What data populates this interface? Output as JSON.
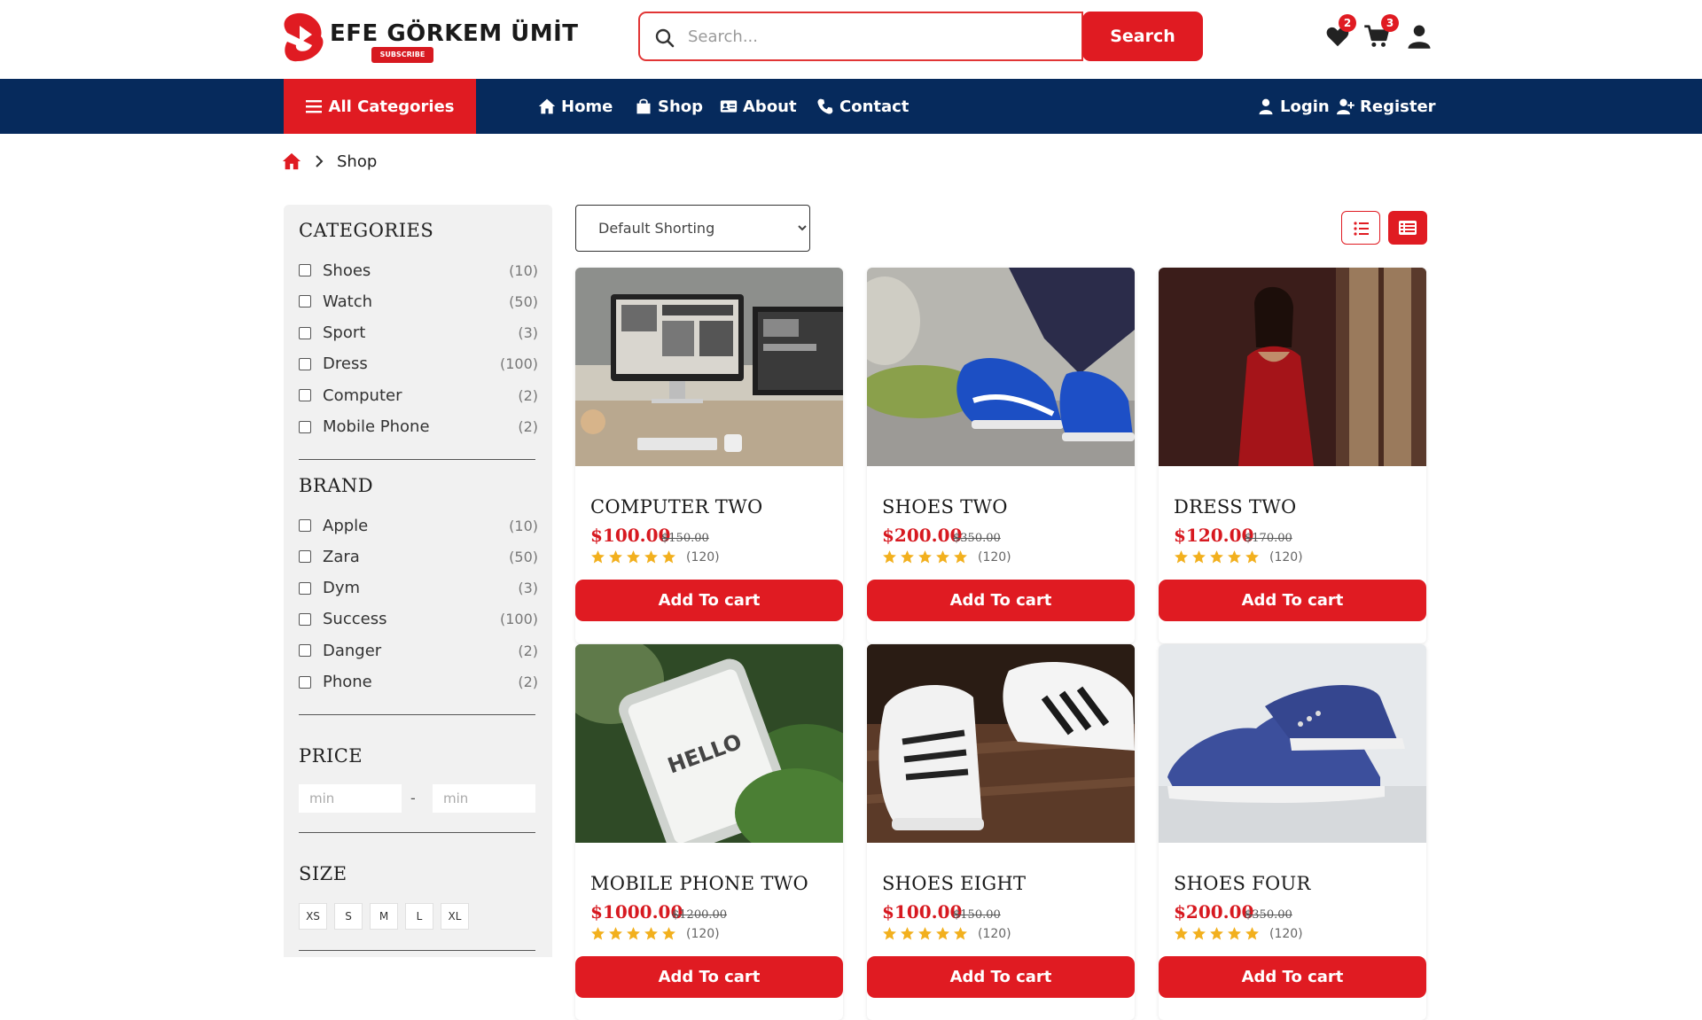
{
  "header": {
    "logo_text": "EFE GÖRKEM ÜMİT",
    "logo_sub": "SUBSCRIBE",
    "search_placeholder": "Search...",
    "search_button": "Search",
    "wishlist_count": "2",
    "cart_count": "3"
  },
  "nav": {
    "all_categories": "All Categories",
    "home": "Home",
    "shop": "Shop",
    "about": "About",
    "contact": "Contact",
    "login": "Login",
    "register": "Register"
  },
  "breadcrumb": {
    "current": "Shop"
  },
  "sidebar": {
    "categories_title": "CATEGORIES",
    "categories": [
      {
        "label": "Shoes",
        "count": "(10)"
      },
      {
        "label": "Watch",
        "count": "(50)"
      },
      {
        "label": "Sport",
        "count": "(3)"
      },
      {
        "label": "Dress",
        "count": "(100)"
      },
      {
        "label": "Computer",
        "count": "(2)"
      },
      {
        "label": "Mobile Phone",
        "count": "(2)"
      }
    ],
    "brand_title": "BRAND",
    "brands": [
      {
        "label": "Apple",
        "count": "(10)"
      },
      {
        "label": "Zara",
        "count": "(50)"
      },
      {
        "label": "Dym",
        "count": "(3)"
      },
      {
        "label": "Success",
        "count": "(100)"
      },
      {
        "label": "Danger",
        "count": "(2)"
      },
      {
        "label": "Phone",
        "count": "(2)"
      }
    ],
    "price_title": "PRICE",
    "price_min_placeholder": "min",
    "price_max_placeholder": "min",
    "price_dash": "-",
    "size_title": "SIZE",
    "sizes": [
      "XS",
      "S",
      "M",
      "L",
      "XL"
    ]
  },
  "toolbar": {
    "sort_selected": "Default Shorting"
  },
  "products": [
    {
      "name": "COMPUTER TWO",
      "price": "$100.00",
      "old_price": "$150.00",
      "reviews": "(120)",
      "rating": 5,
      "button": "Add To cart"
    },
    {
      "name": "SHOES TWO",
      "price": "$200.00",
      "old_price": "$350.00",
      "reviews": "(120)",
      "rating": 5,
      "button": "Add To cart"
    },
    {
      "name": "DRESS TWO",
      "price": "$120.00",
      "old_price": "$170.00",
      "reviews": "(120)",
      "rating": 5,
      "button": "Add To cart"
    },
    {
      "name": "MOBILE PHONE TWO",
      "price": "$1000.00",
      "old_price": "$1200.00",
      "reviews": "(120)",
      "rating": 5,
      "button": "Add To cart"
    },
    {
      "name": "SHOES EIGHT",
      "price": "$100.00",
      "old_price": "$150.00",
      "reviews": "(120)",
      "rating": 5,
      "button": "Add To cart"
    },
    {
      "name": "SHOES FOUR",
      "price": "$200.00",
      "old_price": "$350.00",
      "reviews": "(120)",
      "rating": 5,
      "button": "Add To cart"
    }
  ],
  "colors": {
    "accent_red": "#e01b22",
    "nav_blue": "#062a5c",
    "star_gold": "#f2b01e"
  }
}
